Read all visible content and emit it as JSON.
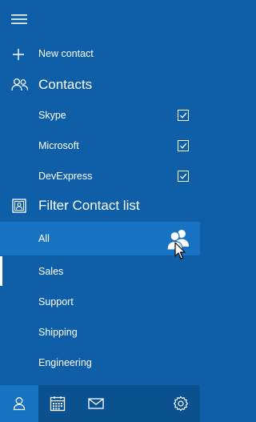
{
  "menu": {
    "icon": "hamburger-icon"
  },
  "actions": {
    "new_contact": "New contact"
  },
  "contacts_section": {
    "title": "Contacts",
    "icon": "people-icon",
    "sources": [
      {
        "label": "Skype",
        "checked": true
      },
      {
        "label": "Microsoft",
        "checked": true
      },
      {
        "label": "DevExpress",
        "checked": true
      }
    ]
  },
  "filter_section": {
    "title": "Filter Contact list",
    "icon": "contact-card-icon",
    "items": [
      {
        "label": "All",
        "selected": true
      },
      {
        "label": "Sales"
      },
      {
        "label": "Support"
      },
      {
        "label": "Shipping"
      },
      {
        "label": "Engineering"
      }
    ]
  },
  "bottom_nav": {
    "tabs": [
      {
        "icon": "person-icon",
        "active": true
      },
      {
        "icon": "calendar-icon"
      },
      {
        "icon": "mail-icon"
      },
      {
        "icon": "settings-icon"
      }
    ]
  },
  "colors": {
    "background": "#0f5ea8",
    "selected": "#1872c4",
    "bottom_bar": "#0b508f",
    "text": "#ffffff"
  }
}
